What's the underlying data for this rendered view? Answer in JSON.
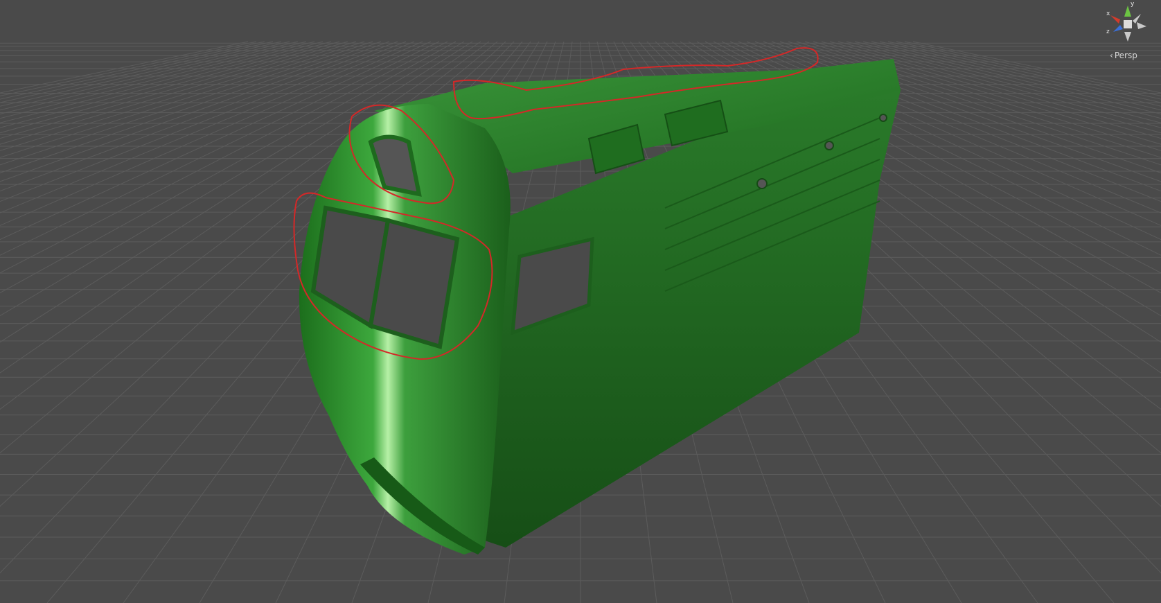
{
  "scene_view": {
    "projection_label": "Persp",
    "background_color": "#4a4a4a",
    "grid_color": "#5c5c5c",
    "model_color": "#2e8a2e",
    "highlight_color": "#d42828"
  },
  "gizmo": {
    "x_label": "x",
    "y_label": "y",
    "z_label": "z",
    "x_color": "#d33b2c",
    "y_color": "#6cc443",
    "z_color": "#3a6fd8",
    "center_color": "#dcdcdc"
  },
  "annotations": {
    "count": 3
  }
}
